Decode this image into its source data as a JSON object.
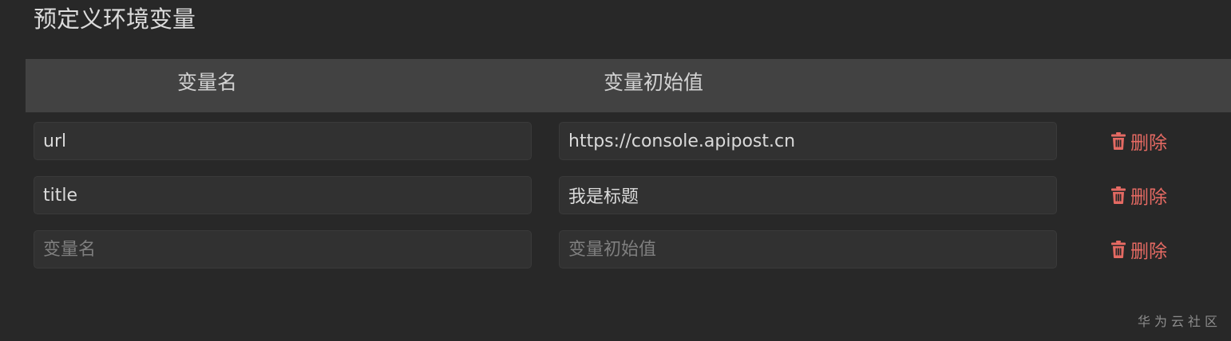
{
  "section": {
    "title": "预定义环境变量"
  },
  "table": {
    "columns": {
      "name": "变量名",
      "value": "变量初始值"
    },
    "rows": [
      {
        "name": "url",
        "value": "https://console.apipost.cn",
        "delete_label": "删除"
      },
      {
        "name": "title",
        "value": "我是标题",
        "delete_label": "删除"
      },
      {
        "name": "",
        "value": "",
        "delete_label": "删除"
      }
    ],
    "placeholders": {
      "name": "变量名",
      "value": "变量初始值"
    }
  },
  "watermark": "华为云社区",
  "colors": {
    "background": "#282828",
    "header_background": "#424242",
    "input_background": "#313131",
    "delete_accent": "#e56a63"
  },
  "icons": {
    "delete": "trash-icon"
  }
}
